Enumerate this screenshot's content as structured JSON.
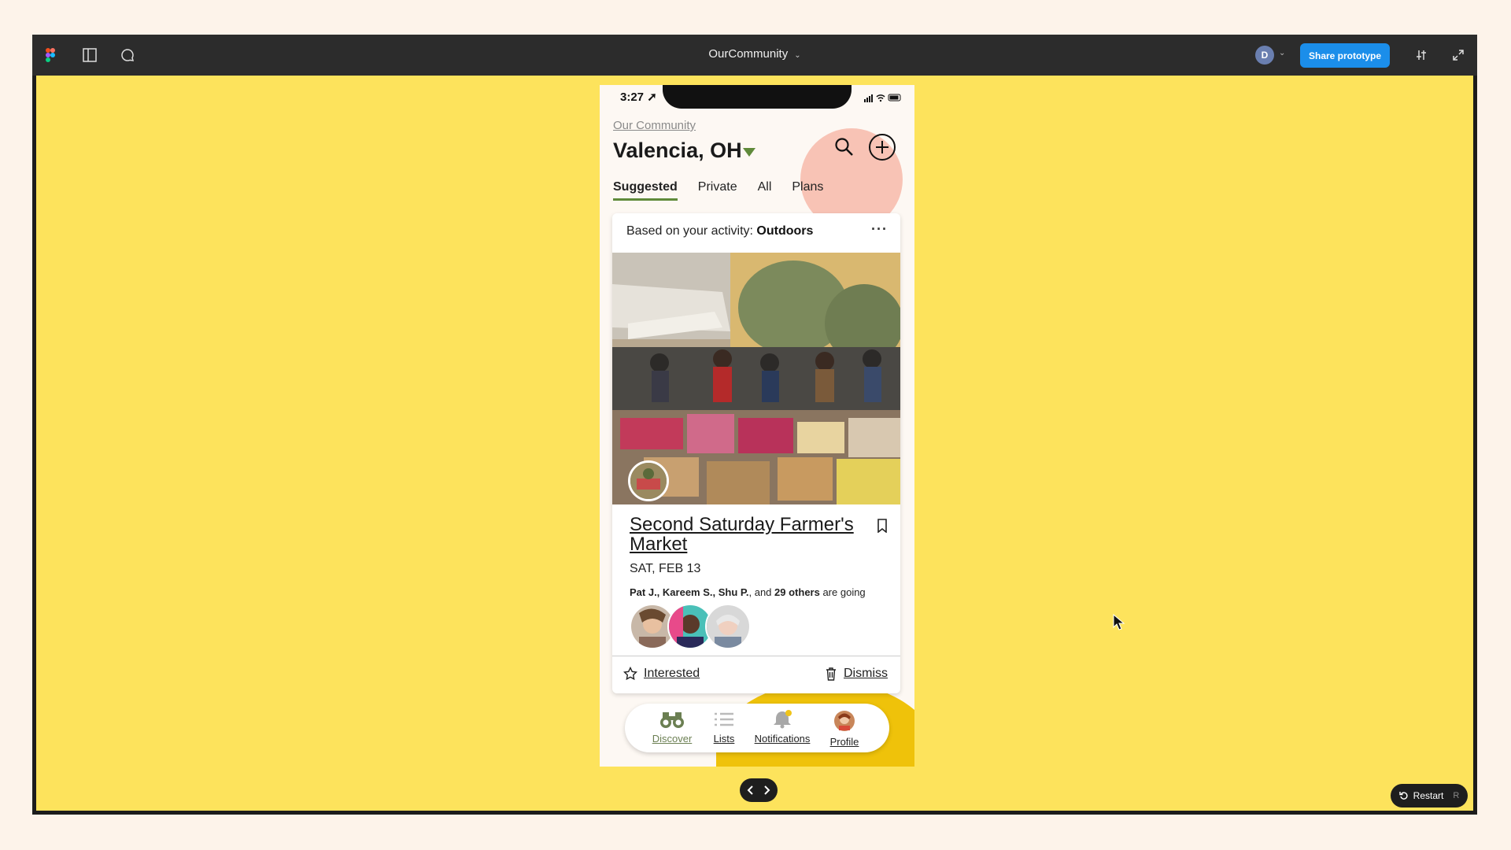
{
  "window": {
    "title": "OurCommunity",
    "user_initial": "D",
    "share_label": "Share prototype",
    "restart_label": "Restart",
    "restart_shortcut": "R"
  },
  "phone": {
    "status_time": "3:27",
    "brand": "Our Community",
    "city": "Valencia, OH",
    "tabs": [
      "Suggested",
      "Private",
      "All",
      "Plans"
    ],
    "active_tab": "Suggested",
    "card": {
      "header_prefix": "Based on your activity: ",
      "header_topic": "Outdoors",
      "event_title": "Second Saturday Farmer's Market",
      "event_date": "SAT, FEB 13",
      "going_names": "Pat J., Kareem S., Shu P.",
      "going_mid": ", and ",
      "going_others": "29 others",
      "going_suffix": " are going",
      "interested_label": "Interested",
      "dismiss_label": "Dismiss"
    },
    "nav": {
      "discover": "Discover",
      "lists": "Lists",
      "notifications": "Notifications",
      "profile": "Profile"
    }
  },
  "colors": {
    "canvas": "#fde35c",
    "accent_green": "#5f8a3a",
    "share_blue": "#1b8eea",
    "blob_pink": "#f8c3b5",
    "blob_yellow": "#efc20a"
  }
}
